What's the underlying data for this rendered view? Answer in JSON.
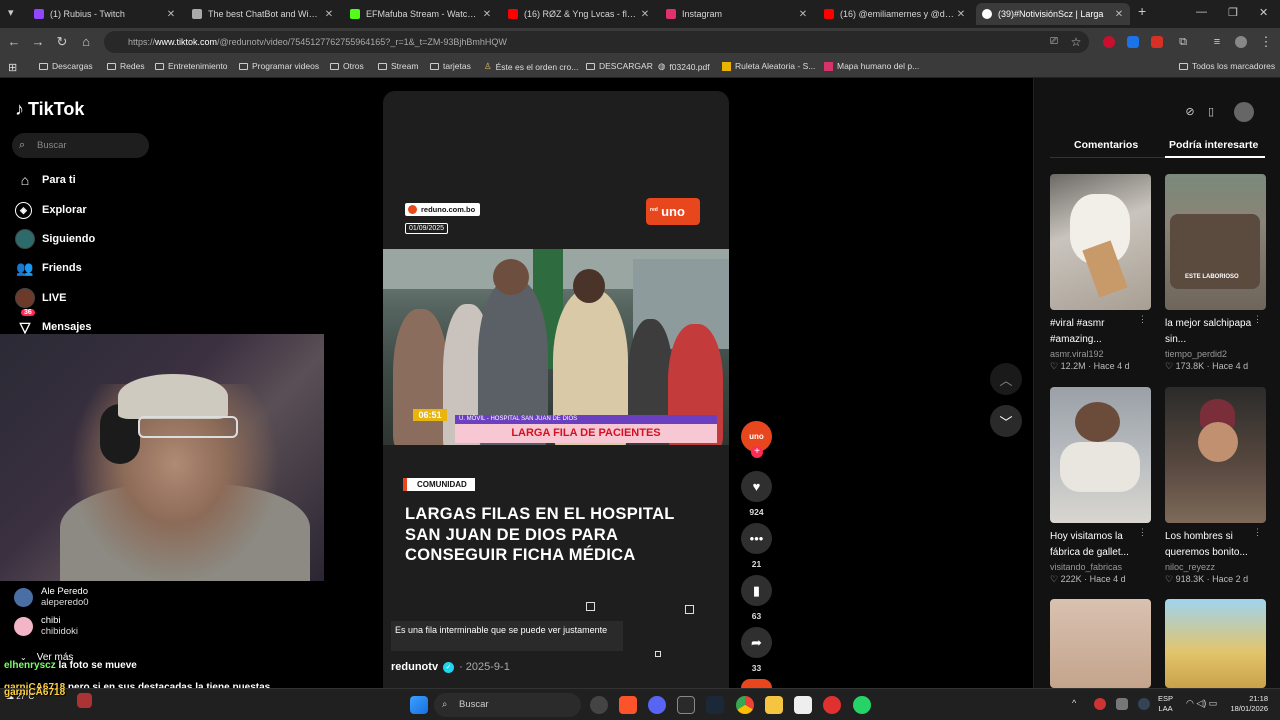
{
  "browser": {
    "tabs": [
      {
        "title": "(1) Rubius - Twitch",
        "color": "#9146ff"
      },
      {
        "title": "The best ChatBot and Widgets",
        "color": "#aaaaaa"
      },
      {
        "title": "EFMafuba Stream - Watch Live",
        "color": "#53fc18"
      },
      {
        "title": "(16) RØZ & Yng Lvcas - flashes",
        "color": "#ff0000"
      },
      {
        "title": "Instagram",
        "color": "#e1306c"
      },
      {
        "title": "(16) @emiliamernes y @duki e",
        "color": "#ff0000"
      },
      {
        "title": "(39)#NotivisiónScz | Larga",
        "color": "#ffffff"
      }
    ],
    "url_prefix": "https://",
    "url_host": "www.tiktok.com",
    "url_path": "/@redunotv/video/7545127762755964165?_r=1&_t=ZM-93BjhBmhHQW",
    "bookmarks": [
      "Descargas",
      "Redes",
      "Entretenimiento",
      "Programar videos",
      "Otros",
      "Stream",
      "tarjetas",
      "Éste es el orden cro...",
      "DESCARGAR",
      "f03240.pdf",
      "Ruleta Aleatoria - S...",
      "Mapa humano del p..."
    ],
    "all_bookmarks": "Todos los marcadores"
  },
  "tiktok": {
    "logo": "TikTok",
    "search_placeholder": "Buscar",
    "nav": [
      {
        "label": "Para ti",
        "icon": "home-icon"
      },
      {
        "label": "Explorar",
        "icon": "compass-icon"
      },
      {
        "label": "Siguiendo",
        "icon": "avatar-icon"
      },
      {
        "label": "Friends",
        "icon": "friends-icon"
      },
      {
        "label": "LIVE",
        "icon": "live-icon"
      },
      {
        "label": "Mensajes",
        "icon": "messages-icon",
        "badge": "36"
      }
    ],
    "following_list": [
      {
        "name": "Ale Peredo",
        "handle": "aleperedo0",
        "color": "#4a6fa5"
      },
      {
        "name": "chibi",
        "handle": "chibidoki",
        "color": "#f2b6c8"
      }
    ],
    "ver_mas": "Ver más",
    "video": {
      "source_tag": "reduno.com.bo",
      "date_tag": "01/09/2025",
      "channel_logo_small": "red",
      "channel_logo": "uno",
      "lower_third_top": "U. MÓVIL - HOSPITAL SAN JUAN DE DIOS",
      "lower_third_main": "LARGA FILA DE PACIENTES",
      "time_box": "06:51",
      "category": "COMUNIDAD",
      "headline": "LARGAS FILAS EN EL HOSPITAL SAN JUAN DE DIOS PARA CONSEGUIR FICHA MÉDICA",
      "caption": "Es una fila interminable que se puede ver justamente",
      "author": "redunotv",
      "post_date": "· 2025-9-1"
    },
    "actions": {
      "avatar_label": "uno",
      "likes": "924",
      "comments": "21",
      "saves": "63",
      "shares": "33"
    },
    "right_panel": {
      "tab_comments": "Comentarios",
      "tab_suggested": "Podría interesarte",
      "cards": [
        {
          "title": "#viral #asmr #amazing...",
          "user": "asmr.viral192",
          "likes": "12.2M",
          "age": "Hace 4 d"
        },
        {
          "title": "la mejor salchipapa sin...",
          "user": "tiempo_perdid2",
          "likes": "173.8K",
          "age": "Hace 4 d",
          "overlay": "ESTE LABORIOSO"
        },
        {
          "title": "Hoy visitamos la fábrica de gallet...",
          "user": "visitando_fabricas",
          "likes": "222K",
          "age": "Hace 4 d"
        },
        {
          "title": "Los hombres si queremos bonito...",
          "user": "niloc_reyezz",
          "likes": "918.3K",
          "age": "Hace 2 d"
        }
      ]
    }
  },
  "stream_chat": [
    {
      "user": "elhenryscz",
      "text": "la foto se mueve"
    },
    {
      "user": "garniCA6718",
      "text": "pero si en sus destacadas la tiene puestas"
    },
    {
      "user": "garniCA6718",
      "text": ""
    }
  ],
  "taskbar": {
    "search": "Buscar",
    "weather": "27°C",
    "lang_top": "ESP",
    "lang_bottom": "LAA",
    "time": "21:18",
    "date": "18/01/2026"
  }
}
